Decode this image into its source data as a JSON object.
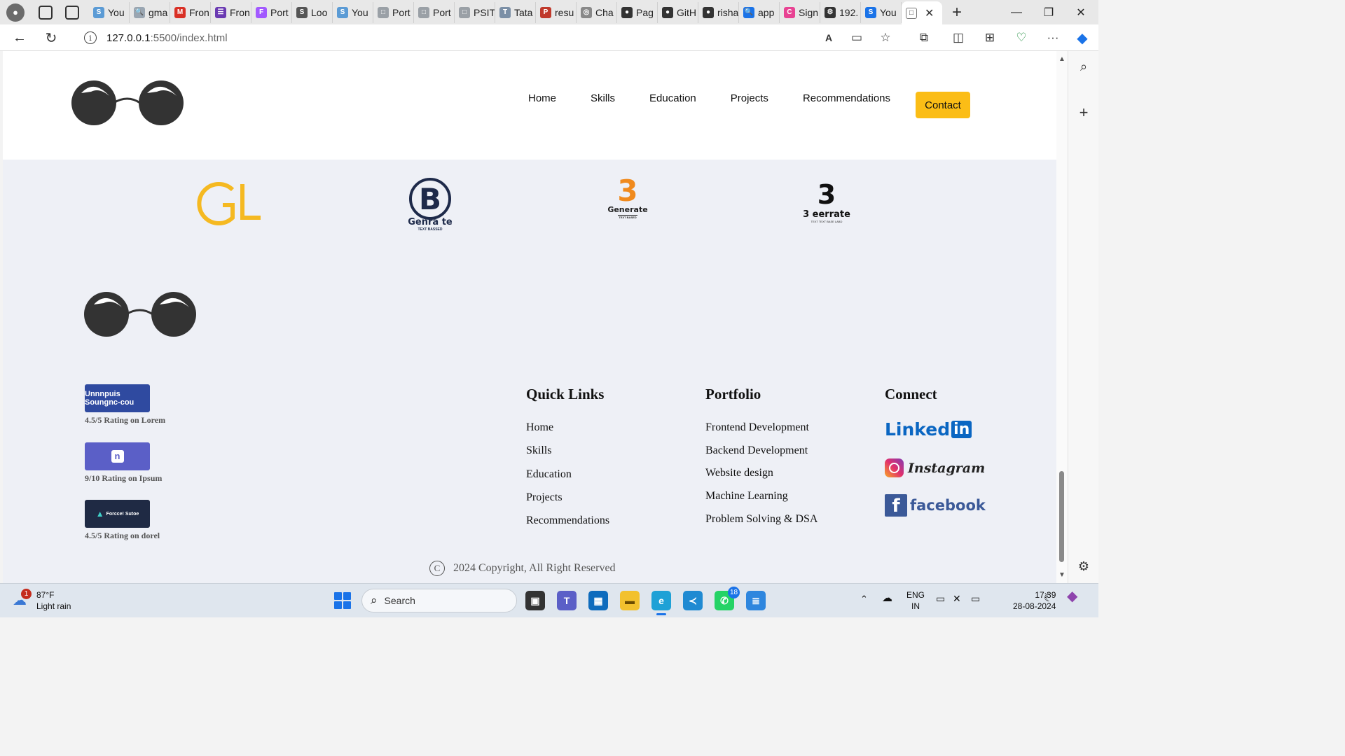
{
  "browser": {
    "tabs": [
      {
        "label": "You",
        "fav": "S",
        "color": "#5b9bd5"
      },
      {
        "label": "gma",
        "fav": "🔍",
        "color": "#9aa6b2"
      },
      {
        "label": "Fron",
        "fav": "M",
        "color": "#d93025"
      },
      {
        "label": "Fron",
        "fav": "☰",
        "color": "#6a3ab2"
      },
      {
        "label": "Port",
        "fav": "F",
        "color": "#a259ff"
      },
      {
        "label": "Loo",
        "fav": "S",
        "color": "#555555"
      },
      {
        "label": "You",
        "fav": "S",
        "color": "#5b9bd5"
      },
      {
        "label": "Port",
        "fav": "□",
        "color": "#9aa0a6"
      },
      {
        "label": "Port",
        "fav": "□",
        "color": "#9aa0a6"
      },
      {
        "label": "PSIT",
        "fav": "□",
        "color": "#9aa0a6"
      },
      {
        "label": "Tata",
        "fav": "T",
        "color": "#7b8fa6"
      },
      {
        "label": "resu",
        "fav": "P",
        "color": "#c0392b"
      },
      {
        "label": "Cha",
        "fav": "◎",
        "color": "#888888"
      },
      {
        "label": "Pag",
        "fav": "●",
        "color": "#333333"
      },
      {
        "label": "GitH",
        "fav": "●",
        "color": "#333333"
      },
      {
        "label": "risha",
        "fav": "●",
        "color": "#333333"
      },
      {
        "label": "app",
        "fav": "🔍",
        "color": "#1a73e8"
      },
      {
        "label": "Sign",
        "fav": "C",
        "color": "#e84393"
      },
      {
        "label": "192.",
        "fav": "⚙",
        "color": "#333333"
      },
      {
        "label": "You",
        "fav": "S",
        "color": "#1a73e8"
      }
    ],
    "active_tab": {
      "fav": "□",
      "close": "✕"
    },
    "new_tab": "+",
    "window_controls": {
      "minimize": "—",
      "restore": "❐",
      "close": "✕"
    },
    "url_host": "127.0.0.1",
    "url_rest": ":5500/index.html",
    "icons": {
      "back": "←",
      "reload": "↻",
      "read_aloud": "A",
      "immersive": "▭",
      "favorite": "☆",
      "extensions": "⧉",
      "split": "◫",
      "collections": "⊞",
      "performance": "♡",
      "more": "···",
      "copilot": "◆"
    }
  },
  "edge_sidebar": {
    "search": "⌕",
    "add": "+",
    "settings": "⚙"
  },
  "site": {
    "nav": [
      "Home",
      "Skills",
      "Education",
      "Projects",
      "Recommendations"
    ],
    "contact": "Contact",
    "partners": [
      {
        "name": "GL",
        "text": "",
        "color": "#f5b921"
      },
      {
        "name": "Genra te",
        "text": "TEXT BASSED",
        "color": "#1e2a4a"
      },
      {
        "name": "Generate",
        "text": "TEXT BASED",
        "color": "#f08a1d"
      },
      {
        "name": "3 eerrate",
        "text": "TEXT TEXT BASE LABD",
        "color": "#111111"
      }
    ],
    "ratings": [
      {
        "badge": "Unnnpuis Soungnc-cou",
        "text": "4.5/5 Rating on Lorem",
        "color": "#2f4aa0"
      },
      {
        "badge": "n",
        "text": "9/10 Rating on Ipsum",
        "color": "#5b5fc7"
      },
      {
        "badge": "Forcce! Sutoe",
        "text": "4.5/5 Rating on dorel",
        "color": "#1f2a44"
      }
    ],
    "quick_links": {
      "title": "Quick Links",
      "items": [
        "Home",
        "Skills",
        "Education",
        "Projects",
        "Recommendations"
      ]
    },
    "portfolio": {
      "title": "Portfolio",
      "items": [
        "Frontend Development",
        "Backend Development",
        "Website design",
        "Machine Learning",
        "Problem Solving & DSA"
      ]
    },
    "connect": {
      "title": "Connect",
      "items": [
        "Linked",
        "in",
        "Instagram",
        "facebook"
      ]
    },
    "copyright": "2024 Copyright, All Right Reserved",
    "copyright_icon": "C"
  },
  "taskbar": {
    "weather_temp": "87°F",
    "weather_desc": "Light rain",
    "weather_badge": "1",
    "search_label": "Search",
    "whatsapp_badge": "18",
    "lang_1": "ENG",
    "lang_2": "IN",
    "time": "17:39",
    "date": "28-08-2024"
  }
}
